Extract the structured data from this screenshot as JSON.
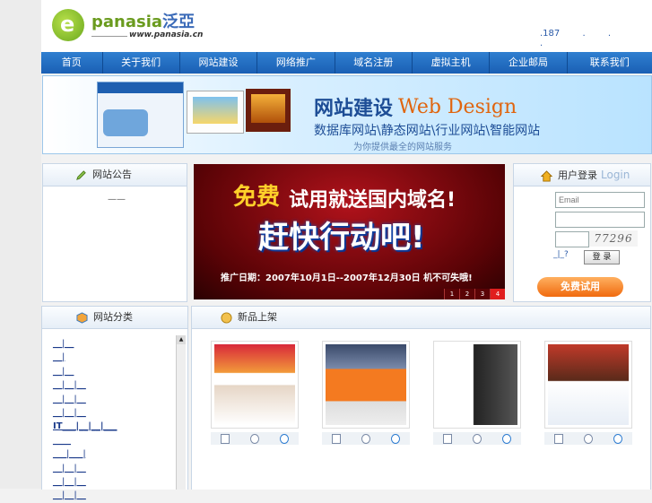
{
  "header": {
    "logo_word_a": "panasia",
    "logo_word_b": "泛亞",
    "logo_url": "www.panasia.cn",
    "top_links": [
      ".187",
      ".",
      ".",
      "."
    ]
  },
  "nav": {
    "items": [
      "首页",
      "关于我们",
      "网站建设",
      "网络推广",
      "域名注册",
      "虚拟主机",
      "企业邮局",
      "联系我们"
    ]
  },
  "banner": {
    "title_cn": "网站建设",
    "title_en": "Web Design",
    "subtitle": "数据库网站\\静态网站\\行业网站\\智能网站",
    "footer": "为你提供最全的网站服务"
  },
  "notice": {
    "title": "网站公告",
    "placeholder_dash": "——"
  },
  "promo": {
    "free": "免费",
    "free_rest": "试用就送国内域名!",
    "action": "赶快行动吧!",
    "date": "推广日期：2007年10月1日--2007年12月30日  机不可失哦!",
    "pages": [
      "1",
      "2",
      "3",
      "4"
    ],
    "active_page": "4"
  },
  "login": {
    "title": "用户登录",
    "title_en": "Login",
    "email_placeholder": "Email",
    "captcha_text": "77296",
    "links": "_|_?",
    "login_button": "登 录",
    "trial_button": "免费试用"
  },
  "categories": {
    "title": "网站分类",
    "items": [
      "__|__",
      "__|",
      "__|__",
      "__|__|__",
      "__|__|__",
      "__|__|__",
      "IT___|__|__|___",
      "____",
      "___|___|",
      "__|__|__",
      "__|__|__",
      "__|__|__"
    ]
  },
  "new_products": {
    "title": "新品上架"
  },
  "icons": {
    "notice": "pencil-icon",
    "login": "house-icon",
    "category": "cube-icon",
    "new": "star-badge-icon",
    "thumb_actions": [
      "document-icon",
      "magnifier-icon",
      "globe-icon"
    ]
  },
  "colors": {
    "nav": "#1a5fb4",
    "accent_orange": "#f06a0e",
    "banner_text": "#1e4e96"
  }
}
